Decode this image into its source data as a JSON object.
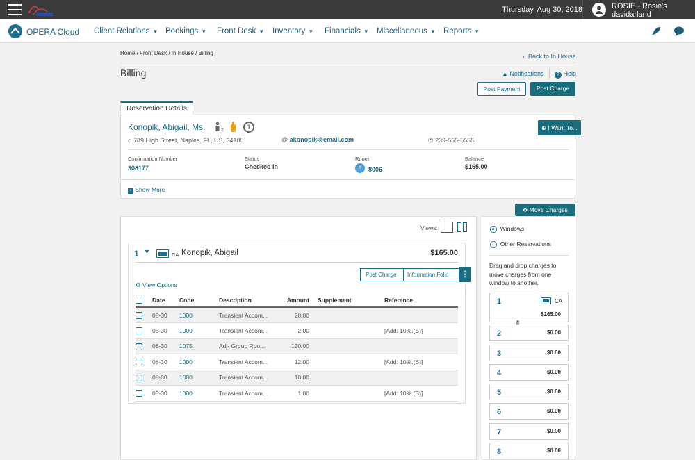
{
  "topbar": {
    "date": "Thursday, Aug 30, 2018",
    "user_line1": "ROSIE - Rosie's",
    "user_line2": "davidarland"
  },
  "nav": {
    "brand": "OPERA Cloud",
    "items": [
      {
        "label": "Client Relations"
      },
      {
        "label": "Bookings"
      },
      {
        "label": "Front Desk"
      },
      {
        "label": "Inventory"
      },
      {
        "label": "Financials"
      },
      {
        "label": "Miscellaneous"
      },
      {
        "label": "Reports"
      }
    ]
  },
  "breadcrumb": "Home / Front Desk / In House / Billing",
  "back_label": "Back to In House",
  "page_title": "Billing",
  "notifications_label": "Notifications",
  "help_label": "Help",
  "post_payment_label": "Post Payment",
  "post_charge_label": "Post Charge",
  "reservation": {
    "tab_label": "Reservation Details",
    "guest_name": "Konopik, Abigail, Ms.",
    "adults_sub": "2",
    "count_badge": "1",
    "address": "789 High Street, Naples, FL, US, 34105",
    "email": "akonopik@email.com",
    "phone": "239-555-5555",
    "i_want_to": "I Want To...",
    "confirmation_label": "Confirmation Number",
    "confirmation_value": "308177",
    "status_label": "Status",
    "status_value": "Checked In",
    "room_label": "Room",
    "room_value": "8006",
    "balance_label": "Balance",
    "balance_value": "$165.00",
    "show_more": "Show More"
  },
  "move_charges_label": "Move Charges",
  "billing": {
    "views_label": "Views:",
    "window_number": "1",
    "payment_code": "CA",
    "guest": "Konopik, Abigail",
    "window_total": "$165.00",
    "post_charge_label": "Post Charge",
    "info_folio_label": "Information Folio",
    "view_options_label": "View Options",
    "columns": [
      "Date",
      "Code",
      "Description",
      "Amount",
      "Supplement",
      "Reference"
    ],
    "rows": [
      {
        "date": "08-30",
        "code": "1000",
        "description": "Transient Accom...",
        "amount": "20.00",
        "supplement": "",
        "reference": ""
      },
      {
        "date": "08-30",
        "code": "1000",
        "description": "Transient Accom...",
        "amount": "2.00",
        "supplement": "",
        "reference": "[Add: 10%.(B)]"
      },
      {
        "date": "08-30",
        "code": "1075",
        "description": "Adj- Group Roo...",
        "amount": "120.00",
        "supplement": "",
        "reference": ""
      },
      {
        "date": "08-30",
        "code": "1000",
        "description": "Transient Accom...",
        "amount": "12.00",
        "supplement": "",
        "reference": "[Add: 10%.(B)]"
      },
      {
        "date": "08-30",
        "code": "1000",
        "description": "Transient Accom...",
        "amount": "10.00",
        "supplement": "",
        "reference": ""
      },
      {
        "date": "08-30",
        "code": "1000",
        "description": "Transient Accom...",
        "amount": "1.00",
        "supplement": "",
        "reference": "[Add: 10%.(B)]"
      }
    ]
  },
  "move_panel": {
    "option_windows": "Windows",
    "option_other": "Other Reservations",
    "instructions": "Drag and drop charges to move charges from one window to another.",
    "window1": {
      "number": "1",
      "code": "CA",
      "amount": "$165.00"
    },
    "windows": [
      {
        "number": "2",
        "amount": "$0.00"
      },
      {
        "number": "3",
        "amount": "$0.00"
      },
      {
        "number": "4",
        "amount": "$0.00"
      },
      {
        "number": "5",
        "amount": "$0.00"
      },
      {
        "number": "6",
        "amount": "$0.00"
      },
      {
        "number": "7",
        "amount": "$0.00"
      },
      {
        "number": "8",
        "amount": "$0.00"
      }
    ]
  },
  "colors": {
    "accent": "#1a6d8c",
    "topbar": "#3b3b3b",
    "button": "#1a6d7c"
  }
}
